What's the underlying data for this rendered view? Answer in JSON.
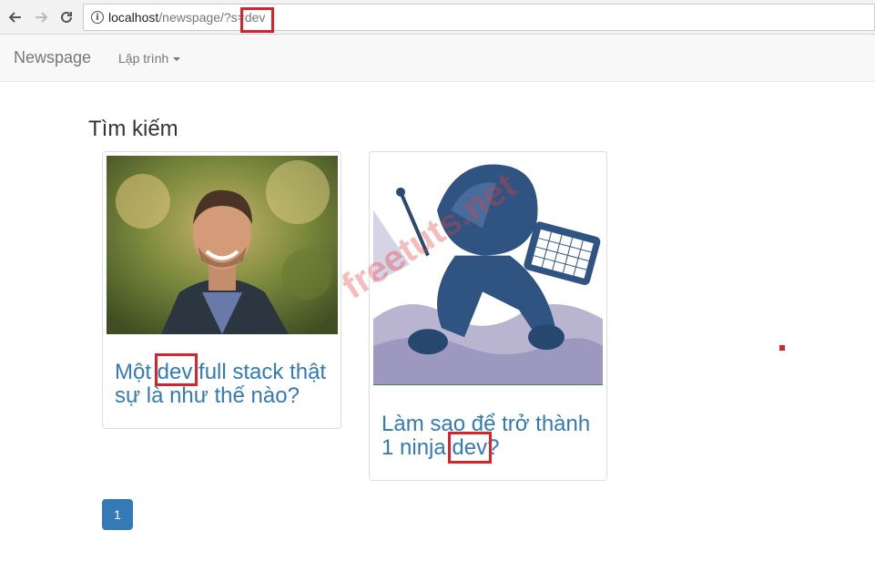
{
  "browser": {
    "url_host": "localhost",
    "url_path": "/newspage/?s=dev",
    "info_icon_glyph": "i",
    "icons": [
      "back-arrow-icon",
      "forward-arrow-icon",
      "reload-icon",
      "info-icon"
    ]
  },
  "navbar": {
    "brand": "Newspage",
    "dropdown_label": "Lập trình"
  },
  "main": {
    "heading": "Tìm kiếm",
    "results": [
      {
        "title": "Một dev full stack thật sự là như thế nào?",
        "image": "smiling-man-photo"
      },
      {
        "title": "Làm sao để trở thành 1 ninja dev?",
        "image": "ninja-developer-illustration"
      }
    ]
  },
  "watermark": "freetuts.net",
  "pagination": {
    "current_page": "1"
  },
  "colors": {
    "link": "#337ab7",
    "highlight": "#d9222a",
    "navbar_bg": "#f8f8f8"
  }
}
